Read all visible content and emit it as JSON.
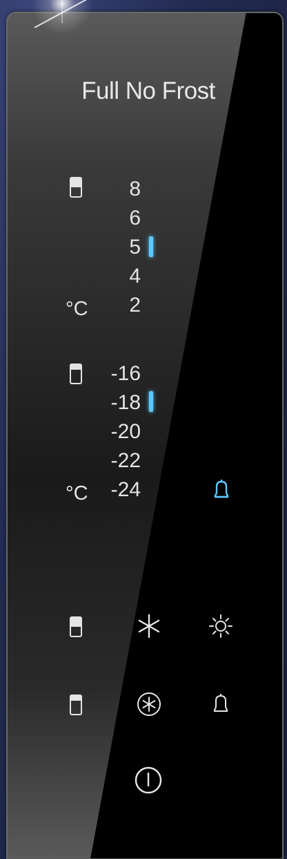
{
  "brand": "Full No Frost",
  "fridge": {
    "levels": [
      "8",
      "6",
      "5",
      "4",
      "2"
    ],
    "selected": "5",
    "unit": "°C"
  },
  "freezer": {
    "levels": [
      "-16",
      "-18",
      "-20",
      "-22",
      "-24"
    ],
    "selected": "-18",
    "unit": "°C"
  },
  "colors": {
    "accent": "#5cc8ff",
    "text": "#e4e4e4",
    "background": "#000000"
  },
  "icons": {
    "alarm_active": "bell-icon",
    "super_cool": "snowflake-icon",
    "light": "sun-icon",
    "super_freeze": "snowflake-circle-icon",
    "alarm": "bell-icon",
    "power": "power-icon"
  }
}
